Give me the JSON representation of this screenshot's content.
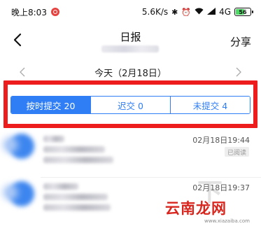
{
  "status_bar": {
    "time": "晚上8:03",
    "network_speed": "5.6K/s",
    "signal": "4G",
    "battery": "56"
  },
  "nav": {
    "title": "日报",
    "share_label": "分享"
  },
  "date_bar": {
    "label": "今天（2月18日）"
  },
  "tabs": [
    {
      "label": "按时提交 20",
      "active": true
    },
    {
      "label": "迟交 0",
      "active": false
    },
    {
      "label": "未提交 4",
      "active": false
    }
  ],
  "list": [
    {
      "time": "02月18日19:44",
      "badge": "已阅读"
    },
    {
      "time": "02月18日19:37"
    }
  ],
  "watermark": {
    "brand": "云南龙网",
    "url": "www.xiazaiba.com"
  },
  "colors": {
    "accent": "#2f7ef5",
    "highlight": "#ee1d1d",
    "watermark": "#d8261e"
  }
}
